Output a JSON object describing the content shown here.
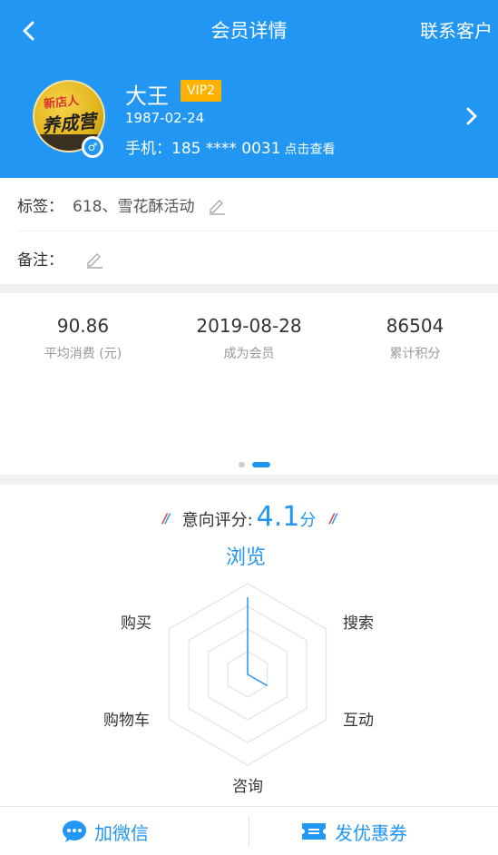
{
  "nav": {
    "title": "会员详情",
    "contact": "联系客户"
  },
  "profile": {
    "name": "大王",
    "vip": "VIP2",
    "birthday": "1987-02-24",
    "phone_label": "手机：",
    "phone": "185 **** 0031",
    "phone_view": "点击查看",
    "gender": "male"
  },
  "tags": {
    "label": "标签：",
    "value": "618、雪花酥活动"
  },
  "remark": {
    "label": "备注：",
    "value": ""
  },
  "stats": [
    {
      "value": "90.86",
      "label": "平均消费 (元)"
    },
    {
      "value": "2019-08-28",
      "label": "成为会员"
    },
    {
      "value": "86504",
      "label": "累计积分"
    }
  ],
  "pager": {
    "count": 2,
    "active": 1
  },
  "intent": {
    "label": "意向评分:",
    "score": "4.1",
    "unit": "分"
  },
  "radar": {
    "axes": [
      "浏览",
      "搜索",
      "互动",
      "咨询",
      "购物车",
      "购买"
    ],
    "values": [
      0.85,
      0,
      0.25,
      0,
      0,
      0
    ],
    "levels": 4
  },
  "bottom": {
    "wechat": "加微信",
    "coupon": "发优惠券"
  },
  "colors": {
    "primary": "#2196f3",
    "vip": "#ffb300",
    "slash_red": "#e53935"
  }
}
